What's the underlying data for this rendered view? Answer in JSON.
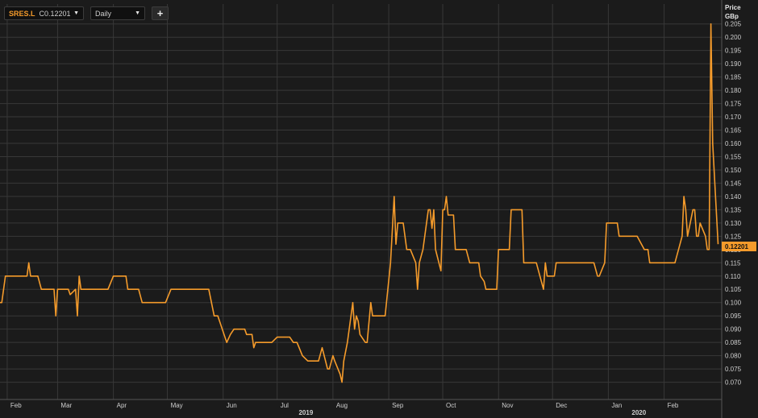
{
  "toolbar": {
    "ticker": "SRES.L",
    "close_prefix": "C",
    "close_value": "0.12201",
    "interval": "Daily",
    "add_label": "+"
  },
  "price_axis": {
    "title": "Price",
    "unit": "GBp"
  },
  "last_price_label": "0.12201",
  "colors": {
    "background": "#1b1b1b",
    "grid": "#383838",
    "line": "#f59b2b",
    "text": "#cfcfcf"
  },
  "chart_data": {
    "type": "line",
    "title": "",
    "series": [
      {
        "name": "SRES.L",
        "points": [
          [
            "2019-01-28",
            0.1
          ],
          [
            "2019-01-29",
            0.1
          ],
          [
            "2019-01-31",
            0.11
          ],
          [
            "2019-02-12",
            0.11
          ],
          [
            "2019-02-13",
            0.115
          ],
          [
            "2019-02-14",
            0.11
          ],
          [
            "2019-02-18",
            0.11
          ],
          [
            "2019-02-20",
            0.105
          ],
          [
            "2019-02-27",
            0.105
          ],
          [
            "2019-02-28",
            0.095
          ],
          [
            "2019-03-01",
            0.105
          ],
          [
            "2019-03-07",
            0.105
          ],
          [
            "2019-03-08",
            0.103
          ],
          [
            "2019-03-11",
            0.105
          ],
          [
            "2019-03-12",
            0.095
          ],
          [
            "2019-03-13",
            0.11
          ],
          [
            "2019-03-14",
            0.105
          ],
          [
            "2019-03-29",
            0.105
          ],
          [
            "2019-04-01",
            0.11
          ],
          [
            "2019-04-08",
            0.11
          ],
          [
            "2019-04-09",
            0.105
          ],
          [
            "2019-04-15",
            0.105
          ],
          [
            "2019-04-17",
            0.1
          ],
          [
            "2019-04-30",
            0.1
          ],
          [
            "2019-05-03",
            0.105
          ],
          [
            "2019-05-24",
            0.105
          ],
          [
            "2019-05-27",
            0.095
          ],
          [
            "2019-05-29",
            0.095
          ],
          [
            "2019-06-03",
            0.085
          ],
          [
            "2019-06-05",
            0.088
          ],
          [
            "2019-06-07",
            0.09
          ],
          [
            "2019-06-13",
            0.09
          ],
          [
            "2019-06-14",
            0.088
          ],
          [
            "2019-06-17",
            0.088
          ],
          [
            "2019-06-18",
            0.083
          ],
          [
            "2019-06-19",
            0.085
          ],
          [
            "2019-06-28",
            0.085
          ],
          [
            "2019-07-01",
            0.087
          ],
          [
            "2019-07-08",
            0.087
          ],
          [
            "2019-07-10",
            0.085
          ],
          [
            "2019-07-12",
            0.085
          ],
          [
            "2019-07-15",
            0.08
          ],
          [
            "2019-07-18",
            0.078
          ],
          [
            "2019-07-24",
            0.078
          ],
          [
            "2019-07-26",
            0.083
          ],
          [
            "2019-07-29",
            0.075
          ],
          [
            "2019-07-30",
            0.075
          ],
          [
            "2019-08-01",
            0.08
          ],
          [
            "2019-08-02",
            0.078
          ],
          [
            "2019-08-05",
            0.073
          ],
          [
            "2019-08-06",
            0.07
          ],
          [
            "2019-08-07",
            0.078
          ],
          [
            "2019-08-09",
            0.085
          ],
          [
            "2019-08-12",
            0.1
          ],
          [
            "2019-08-13",
            0.09
          ],
          [
            "2019-08-14",
            0.095
          ],
          [
            "2019-08-15",
            0.093
          ],
          [
            "2019-08-16",
            0.088
          ],
          [
            "2019-08-19",
            0.085
          ],
          [
            "2019-08-20",
            0.085
          ],
          [
            "2019-08-22",
            0.1
          ],
          [
            "2019-08-23",
            0.095
          ],
          [
            "2019-08-30",
            0.095
          ],
          [
            "2019-09-02",
            0.115
          ],
          [
            "2019-09-04",
            0.14
          ],
          [
            "2019-09-05",
            0.122
          ],
          [
            "2019-09-06",
            0.13
          ],
          [
            "2019-09-09",
            0.13
          ],
          [
            "2019-09-11",
            0.12
          ],
          [
            "2019-09-13",
            0.12
          ],
          [
            "2019-09-16",
            0.115
          ],
          [
            "2019-09-17",
            0.105
          ],
          [
            "2019-09-18",
            0.115
          ],
          [
            "2019-09-20",
            0.12
          ],
          [
            "2019-09-23",
            0.135
          ],
          [
            "2019-09-24",
            0.135
          ],
          [
            "2019-09-25",
            0.128
          ],
          [
            "2019-09-26",
            0.135
          ],
          [
            "2019-09-27",
            0.12
          ],
          [
            "2019-09-30",
            0.112
          ],
          [
            "2019-10-01",
            0.135
          ],
          [
            "2019-10-02",
            0.135
          ],
          [
            "2019-10-03",
            0.14
          ],
          [
            "2019-10-04",
            0.133
          ],
          [
            "2019-10-07",
            0.133
          ],
          [
            "2019-10-08",
            0.12
          ],
          [
            "2019-10-14",
            0.12
          ],
          [
            "2019-10-16",
            0.115
          ],
          [
            "2019-10-21",
            0.115
          ],
          [
            "2019-10-22",
            0.11
          ],
          [
            "2019-10-24",
            0.108
          ],
          [
            "2019-10-25",
            0.105
          ],
          [
            "2019-10-31",
            0.105
          ],
          [
            "2019-11-01",
            0.12
          ],
          [
            "2019-11-07",
            0.12
          ],
          [
            "2019-11-08",
            0.135
          ],
          [
            "2019-11-14",
            0.135
          ],
          [
            "2019-11-15",
            0.115
          ],
          [
            "2019-11-22",
            0.115
          ],
          [
            "2019-11-26",
            0.105
          ],
          [
            "2019-11-27",
            0.115
          ],
          [
            "2019-11-28",
            0.11
          ],
          [
            "2019-12-02",
            0.11
          ],
          [
            "2019-12-03",
            0.115
          ],
          [
            "2019-12-24",
            0.115
          ],
          [
            "2019-12-26",
            0.11
          ],
          [
            "2019-12-27",
            0.11
          ],
          [
            "2019-12-30",
            0.115
          ],
          [
            "2019-12-31",
            0.13
          ],
          [
            "2020-01-06",
            0.13
          ],
          [
            "2020-01-07",
            0.125
          ],
          [
            "2020-01-17",
            0.125
          ],
          [
            "2020-01-21",
            0.12
          ],
          [
            "2020-01-23",
            0.12
          ],
          [
            "2020-01-24",
            0.115
          ],
          [
            "2020-02-07",
            0.115
          ],
          [
            "2020-02-11",
            0.125
          ],
          [
            "2020-02-12",
            0.14
          ],
          [
            "2020-02-13",
            0.135
          ],
          [
            "2020-02-14",
            0.125
          ],
          [
            "2020-02-17",
            0.135
          ],
          [
            "2020-02-18",
            0.135
          ],
          [
            "2020-02-19",
            0.125
          ],
          [
            "2020-02-20",
            0.125
          ],
          [
            "2020-02-21",
            0.13
          ],
          [
            "2020-02-24",
            0.125
          ],
          [
            "2020-02-25",
            0.12
          ],
          [
            "2020-02-26",
            0.12
          ],
          [
            "2020-02-27",
            0.205
          ],
          [
            "2020-02-28",
            0.16
          ],
          [
            "2020-03-02",
            0.12201
          ]
        ]
      }
    ],
    "xlabel": "",
    "ylabel": "Price GBp",
    "x_range": [
      "2019-01-28",
      "2020-03-04"
    ],
    "ylim": [
      0.0635,
      0.2125
    ],
    "y_ticks": [
      "0.070",
      "0.075",
      "0.080",
      "0.085",
      "0.090",
      "0.095",
      "0.100",
      "0.105",
      "0.110",
      "0.115",
      "0.120",
      "0.125",
      "0.130",
      "0.135",
      "0.140",
      "0.145",
      "0.150",
      "0.155",
      "0.160",
      "0.165",
      "0.170",
      "0.175",
      "0.180",
      "0.185",
      "0.190",
      "0.195",
      "0.200",
      "0.205"
    ],
    "month_ticks": [
      {
        "label": "Feb",
        "date": "2019-02-01"
      },
      {
        "label": "Mar",
        "date": "2019-03-01"
      },
      {
        "label": "Apr",
        "date": "2019-04-01"
      },
      {
        "label": "May",
        "date": "2019-05-01"
      },
      {
        "label": "Jun",
        "date": "2019-06-01"
      },
      {
        "label": "Jul",
        "date": "2019-07-01"
      },
      {
        "label": "Aug",
        "date": "2019-08-01"
      },
      {
        "label": "Sep",
        "date": "2019-09-01"
      },
      {
        "label": "Oct",
        "date": "2019-10-01"
      },
      {
        "label": "Nov",
        "date": "2019-11-01"
      },
      {
        "label": "Dec",
        "date": "2019-12-01"
      },
      {
        "label": "Jan",
        "date": "2020-01-01"
      },
      {
        "label": "Feb",
        "date": "2020-02-01"
      }
    ],
    "year_labels": [
      {
        "label": "2019",
        "date": "2019-07-13"
      },
      {
        "label": "2020",
        "date": "2020-01-14"
      }
    ],
    "grid": true
  }
}
